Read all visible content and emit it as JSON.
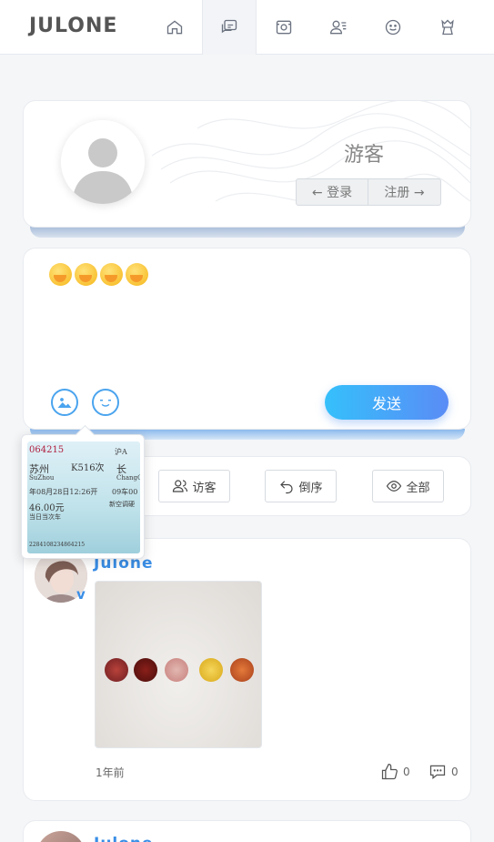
{
  "header": {
    "logo": "JULONE",
    "nav": [
      {
        "icon": "home-icon"
      },
      {
        "icon": "chat-icon",
        "active": true
      },
      {
        "icon": "photo-frame-icon"
      },
      {
        "icon": "contact-card-icon"
      },
      {
        "icon": "smile-icon"
      },
      {
        "icon": "badge-icon"
      }
    ]
  },
  "profile": {
    "name": "游客",
    "login_label": "← 登录",
    "register_label": "注册 →"
  },
  "composer": {
    "emojis": [
      "shy-cover-mouth-emoji",
      "shy-cover-mouth-emoji",
      "shy-cover-mouth-emoji",
      "blush-smile-emoji"
    ],
    "image_tool_icon": "image-icon",
    "emoji_tool_icon": "emoji-icon",
    "send_label": "发送"
  },
  "preview": {
    "ticket_number": "064215",
    "from_city": "苏州",
    "from_pinyin": "SuZhou",
    "train": "K516次",
    "to_city": "长",
    "to_pinyin": "ChangC",
    "date": "年08月28日12:26开",
    "car": "09车00",
    "price": "46.00元",
    "note": "当日当次车",
    "ac": "新空调硬",
    "right_top": "沪A",
    "serial": "2284108234864215"
  },
  "filters": {
    "visitor_label": "访客",
    "reverse_label": "倒序",
    "all_label": "全部"
  },
  "post": {
    "author": "Julone",
    "verified": "v",
    "time": "1年前",
    "likes": "0",
    "comments": "0"
  },
  "post2": {
    "author": "Julone"
  },
  "colors": {
    "accent": "#3a8ee6",
    "send_gradient_start": "#35c0fb",
    "send_gradient_end": "#5a8cf6"
  }
}
